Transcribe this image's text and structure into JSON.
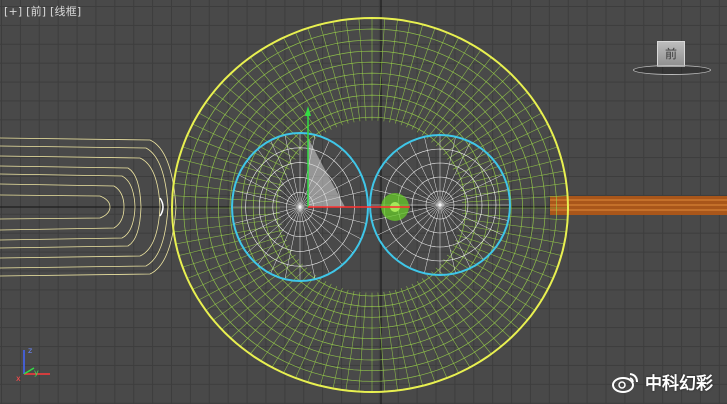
{
  "viewport": {
    "label_parts": [
      "[+]",
      "[前]",
      "[线框]"
    ]
  },
  "viewcube": {
    "face_label": "前"
  },
  "axis_tripod": {
    "x_label": "x",
    "y_label": "y",
    "z_label": "z"
  },
  "watermark": {
    "text": "中科幻彩"
  },
  "colors": {
    "grid_line": "#3d3d3d",
    "background": "#494949",
    "axis_line": "#111111",
    "outer_mesh": "#9ad24a",
    "outer_outline": "#e8f050",
    "inner_mesh": "#ffffff",
    "inner_outline": "#3fc6e8",
    "nucleus": "#6fcf2a",
    "left_object": "#f2eaa0",
    "right_bar": "#c86a1e"
  },
  "icons": [
    "weibo-logo-icon",
    "axis-tripod-icon",
    "viewcube-icon"
  ]
}
